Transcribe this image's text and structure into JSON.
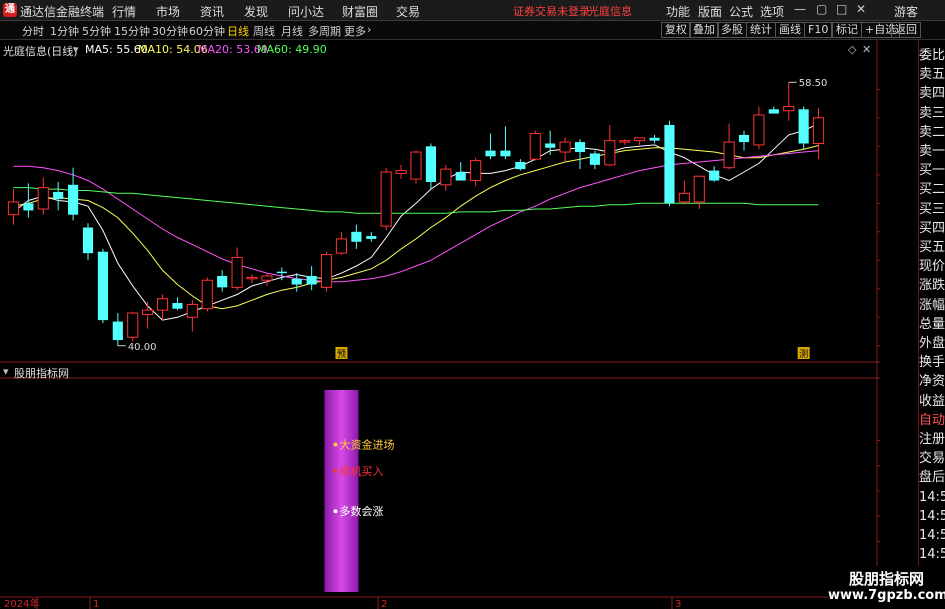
{
  "topbar": {
    "title": "通达信金融终端",
    "menu": [
      "行情",
      "市场",
      "资讯",
      "发现",
      "问小达",
      "财富圈",
      "交易"
    ],
    "alert": "证券交易未登录",
    "stock_name": "光庭信息",
    "right_menu": [
      "功能",
      "版面",
      "公式",
      "选项"
    ],
    "guest": "游客"
  },
  "toolbar": {
    "periods": [
      "分时",
      "1分钟",
      "5分钟",
      "15分钟",
      "30分钟",
      "60分钟",
      "日线",
      "周线",
      "月线",
      "多周期",
      "更多"
    ],
    "active_period": "日线",
    "tools": [
      "复权",
      "叠加",
      "多股",
      "统计",
      "画线",
      "F10",
      "标记",
      "+自选",
      "返回"
    ]
  },
  "chart_header": {
    "title": "光庭信息(日线)",
    "ma": [
      {
        "label": "MA5: 55.60",
        "color": "#ffffff"
      },
      {
        "label": "MA10: 54.06",
        "color": "#ffff55"
      },
      {
        "label": "MA20: 53.69",
        "color": "#ff55ff"
      },
      {
        "label": "MA60: 49.90",
        "color": "#55ff55"
      }
    ]
  },
  "indicator": {
    "title": "股朋指标网",
    "signals": [
      "大资金进场",
      "择机买入",
      "多数会涨"
    ],
    "signal_colors": [
      "#ffcc33",
      "#ff3333",
      "#ffffff"
    ]
  },
  "sidebar": [
    "委比",
    "卖五",
    "卖四",
    "卖三",
    "卖二",
    "卖一",
    "买一",
    "买二",
    "买三",
    "买四",
    "买五",
    "现价",
    "涨跌",
    "涨幅",
    "总量",
    "外盘",
    "换手",
    "净资",
    "收益",
    "自动",
    "注册",
    "交易",
    "盘后",
    "14:56",
    "14:56",
    "14:56",
    "14:56",
    "14:56",
    "14:56"
  ],
  "watermark": {
    "line1": "股朋指标网",
    "line2": "www.7gpzb.com"
  },
  "chart_data": [
    {
      "type": "candlestick",
      "title": "光庭信息(日线)",
      "ylim": [
        39.0,
        59.5
      ],
      "yticks": [
        40,
        42,
        44,
        46,
        48,
        50,
        52,
        54,
        56,
        58
      ],
      "annotations": [
        {
          "label": "58.50"
        },
        {
          "label": "40.00"
        }
      ],
      "markers": [
        "预",
        "测"
      ],
      "candles": [
        {
          "o": 49.2,
          "h": 51.0,
          "l": 48.5,
          "c": 50.1
        },
        {
          "o": 50.0,
          "h": 51.4,
          "l": 49.0,
          "c": 49.5
        },
        {
          "o": 49.6,
          "h": 51.8,
          "l": 49.2,
          "c": 51.1
        },
        {
          "o": 50.8,
          "h": 51.5,
          "l": 49.5,
          "c": 50.3
        },
        {
          "o": 51.3,
          "h": 52.5,
          "l": 48.8,
          "c": 49.2
        },
        {
          "o": 48.3,
          "h": 48.6,
          "l": 46.0,
          "c": 46.5
        },
        {
          "o": 46.6,
          "h": 46.8,
          "l": 41.6,
          "c": 41.8
        },
        {
          "o": 41.7,
          "h": 42.3,
          "l": 40.0,
          "c": 40.4
        },
        {
          "o": 40.6,
          "h": 42.4,
          "l": 40.3,
          "c": 42.3
        },
        {
          "o": 42.2,
          "h": 43.1,
          "l": 41.2,
          "c": 42.5
        },
        {
          "o": 42.5,
          "h": 43.6,
          "l": 41.8,
          "c": 43.3
        },
        {
          "o": 43.0,
          "h": 43.4,
          "l": 42.5,
          "c": 42.6
        },
        {
          "o": 42.0,
          "h": 43.2,
          "l": 41.0,
          "c": 42.9
        },
        {
          "o": 42.6,
          "h": 44.8,
          "l": 42.4,
          "c": 44.6
        },
        {
          "o": 44.9,
          "h": 45.3,
          "l": 43.8,
          "c": 44.1
        },
        {
          "o": 44.1,
          "h": 46.9,
          "l": 43.9,
          "c": 46.2
        },
        {
          "o": 44.7,
          "h": 45.0,
          "l": 44.4,
          "c": 44.8
        },
        {
          "o": 44.6,
          "h": 45.1,
          "l": 44.2,
          "c": 44.9
        },
        {
          "o": 45.2,
          "h": 45.5,
          "l": 44.6,
          "c": 45.1
        },
        {
          "o": 44.7,
          "h": 45.1,
          "l": 43.8,
          "c": 44.3
        },
        {
          "o": 44.9,
          "h": 45.6,
          "l": 43.9,
          "c": 44.3
        },
        {
          "o": 44.1,
          "h": 46.6,
          "l": 43.8,
          "c": 46.4
        },
        {
          "o": 46.5,
          "h": 48.0,
          "l": 46.4,
          "c": 47.5
        },
        {
          "o": 48.0,
          "h": 48.5,
          "l": 46.8,
          "c": 47.3
        },
        {
          "o": 47.7,
          "h": 48.0,
          "l": 47.3,
          "c": 47.5
        },
        {
          "o": 48.4,
          "h": 52.5,
          "l": 48.1,
          "c": 52.2
        },
        {
          "o": 52.1,
          "h": 52.7,
          "l": 51.7,
          "c": 52.3
        },
        {
          "o": 51.7,
          "h": 53.7,
          "l": 51.4,
          "c": 53.6
        },
        {
          "o": 54.0,
          "h": 54.2,
          "l": 51.0,
          "c": 51.5
        },
        {
          "o": 51.3,
          "h": 52.7,
          "l": 50.9,
          "c": 52.4
        },
        {
          "o": 52.2,
          "h": 52.9,
          "l": 51.9,
          "c": 51.6
        },
        {
          "o": 51.6,
          "h": 53.2,
          "l": 51.2,
          "c": 53.0
        },
        {
          "o": 53.7,
          "h": 54.9,
          "l": 53.1,
          "c": 53.3
        },
        {
          "o": 53.7,
          "h": 55.4,
          "l": 53.1,
          "c": 53.3
        },
        {
          "o": 52.9,
          "h": 53.1,
          "l": 52.3,
          "c": 52.4
        },
        {
          "o": 53.1,
          "h": 55.1,
          "l": 53.0,
          "c": 54.9
        },
        {
          "o": 54.2,
          "h": 55.1,
          "l": 53.4,
          "c": 53.9
        },
        {
          "o": 53.6,
          "h": 54.6,
          "l": 52.9,
          "c": 54.3
        },
        {
          "o": 54.3,
          "h": 54.5,
          "l": 52.4,
          "c": 53.6
        },
        {
          "o": 53.5,
          "h": 53.7,
          "l": 52.4,
          "c": 52.7
        },
        {
          "o": 52.7,
          "h": 55.5,
          "l": 52.6,
          "c": 54.4
        },
        {
          "o": 54.3,
          "h": 54.5,
          "l": 54.1,
          "c": 54.4
        },
        {
          "o": 54.4,
          "h": 54.6,
          "l": 54.1,
          "c": 54.6
        },
        {
          "o": 54.6,
          "h": 54.8,
          "l": 54.2,
          "c": 54.4
        },
        {
          "o": 55.5,
          "h": 55.8,
          "l": 49.8,
          "c": 50.0
        },
        {
          "o": 50.1,
          "h": 51.6,
          "l": 49.9,
          "c": 50.7
        },
        {
          "o": 50.1,
          "h": 51.8,
          "l": 49.6,
          "c": 51.9
        },
        {
          "o": 52.3,
          "h": 52.6,
          "l": 51.5,
          "c": 51.6
        },
        {
          "o": 52.5,
          "h": 55.6,
          "l": 52.4,
          "c": 54.3
        },
        {
          "o": 54.8,
          "h": 55.1,
          "l": 53.7,
          "c": 54.3
        },
        {
          "o": 54.1,
          "h": 56.8,
          "l": 53.8,
          "c": 56.2
        },
        {
          "o": 56.6,
          "h": 56.8,
          "l": 56.3,
          "c": 56.3
        },
        {
          "o": 56.5,
          "h": 58.5,
          "l": 55.8,
          "c": 56.8
        },
        {
          "o": 56.6,
          "h": 56.8,
          "l": 53.8,
          "c": 54.2
        },
        {
          "o": 54.2,
          "h": 56.7,
          "l": 53.1,
          "c": 56.0
        }
      ],
      "series": [
        {
          "name": "MA5",
          "values": [
            49.4,
            50.2,
            50.5,
            50.2,
            50.1,
            49.8,
            48.1,
            45.8,
            44.2,
            42.8,
            41.8,
            42.0,
            42.4,
            42.8,
            43.2,
            43.6,
            44.2,
            44.5,
            44.8,
            45.0,
            44.8,
            44.7,
            45.1,
            45.6,
            46.2,
            47.6,
            49.1,
            50.0,
            51.0,
            51.7,
            52.2,
            52.1,
            52.1,
            52.3,
            52.6,
            53.1,
            53.7,
            53.8,
            53.9,
            53.8,
            53.6,
            53.9,
            54.0,
            54.1,
            53.6,
            53.2,
            52.6,
            52.0,
            51.6,
            52.2,
            52.8,
            53.8,
            54.8,
            55.1,
            55.6
          ]
        },
        {
          "name": "MA10",
          "values": [
            49.8,
            50.0,
            50.3,
            50.4,
            50.3,
            50.2,
            49.7,
            49.0,
            47.9,
            46.7,
            45.3,
            44.3,
            43.5,
            42.8,
            42.6,
            42.8,
            43.2,
            43.6,
            43.9,
            44.1,
            44.4,
            44.6,
            44.8,
            45.1,
            45.4,
            46.0,
            46.8,
            47.5,
            48.3,
            49.0,
            49.8,
            50.5,
            51.1,
            51.6,
            52.0,
            52.3,
            52.6,
            52.9,
            53.1,
            53.3,
            53.5,
            53.7,
            53.8,
            53.9,
            53.9,
            53.8,
            53.7,
            53.6,
            53.4,
            53.2,
            53.2,
            53.4,
            53.6,
            53.8,
            54.06
          ]
        },
        {
          "name": "MA20",
          "values": [
            52.6,
            52.6,
            52.5,
            52.3,
            52.0,
            51.6,
            51.0,
            50.3,
            49.6,
            48.9,
            48.2,
            47.6,
            47.1,
            46.6,
            46.1,
            45.7,
            45.4,
            45.1,
            44.9,
            44.7,
            44.6,
            44.5,
            44.5,
            44.6,
            44.7,
            44.9,
            45.2,
            45.6,
            46.0,
            46.6,
            47.2,
            47.8,
            48.4,
            48.9,
            49.4,
            49.8,
            50.3,
            50.7,
            51.1,
            51.4,
            51.7,
            52.0,
            52.3,
            52.5,
            52.7,
            52.8,
            52.9,
            53.0,
            53.1,
            53.2,
            53.3,
            53.4,
            53.5,
            53.6,
            53.69
          ]
        },
        {
          "name": "MA60",
          "values": [
            51.1,
            51.1,
            51.0,
            51.0,
            50.9,
            50.9,
            50.8,
            50.7,
            50.7,
            50.6,
            50.5,
            50.4,
            50.3,
            50.2,
            50.1,
            50.0,
            49.9,
            49.8,
            49.7,
            49.6,
            49.5,
            49.4,
            49.4,
            49.3,
            49.3,
            49.3,
            49.3,
            49.3,
            49.3,
            49.3,
            49.4,
            49.4,
            49.4,
            49.5,
            49.5,
            49.6,
            49.6,
            49.7,
            49.8,
            49.8,
            49.9,
            49.9,
            50.0,
            50.0,
            50.0,
            50.0,
            50.0,
            50.0,
            50.0,
            50.0,
            49.9,
            49.9,
            49.9,
            49.9,
            49.9
          ]
        }
      ]
    },
    {
      "type": "bar",
      "title": "股朋指标网",
      "ylim": [
        0,
        20
      ],
      "yticks": [
        5.0,
        7.5,
        10.0,
        12.5,
        15.0
      ],
      "bars": [
        {
          "index": 22,
          "value": 20
        }
      ],
      "signal_levels": [
        14.6,
        12.0,
        8.0
      ]
    }
  ],
  "timeline": [
    "2024年",
    "1",
    "2",
    "3"
  ]
}
